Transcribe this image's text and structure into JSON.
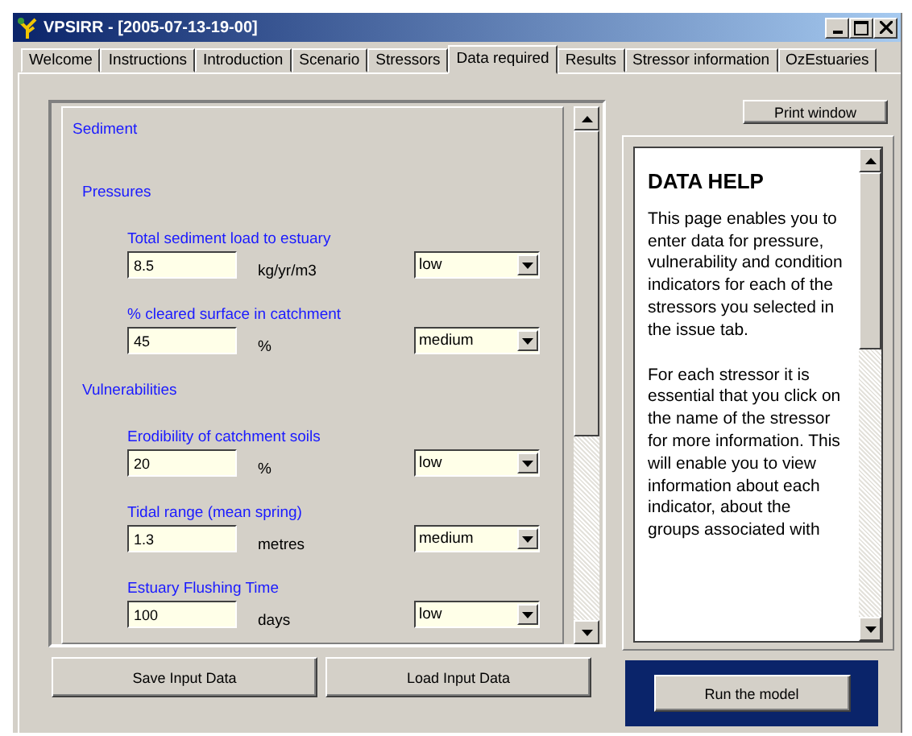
{
  "window": {
    "title": "VPSIRR - [2005-07-13-19-00]"
  },
  "tabs": [
    {
      "label": "Welcome",
      "selected": false
    },
    {
      "label": "Instructions",
      "selected": false
    },
    {
      "label": "Introduction",
      "selected": false
    },
    {
      "label": "Scenario",
      "selected": false
    },
    {
      "label": "Stressors",
      "selected": false
    },
    {
      "label": "Data required",
      "selected": true
    },
    {
      "label": "Results",
      "selected": false
    },
    {
      "label": "Stressor information",
      "selected": false
    },
    {
      "label": "OzEstuaries",
      "selected": false
    }
  ],
  "data_form": {
    "title": "Sediment",
    "groups": [
      {
        "title": "Pressures",
        "fields": [
          {
            "label": "Total sediment load to estuary",
            "value": "8.5",
            "unit": "kg/yr/m3",
            "rating": "low"
          },
          {
            "label": "% cleared surface in catchment",
            "value": "45",
            "unit": "%",
            "rating": "medium"
          }
        ]
      },
      {
        "title": "Vulnerabilities",
        "fields": [
          {
            "label": "Erodibility of catchment soils",
            "value": "20",
            "unit": "%",
            "rating": "low"
          },
          {
            "label": "Tidal range (mean spring)",
            "value": "1.3",
            "unit": "metres",
            "rating": "medium"
          },
          {
            "label": "Estuary Flushing Time",
            "value": "100",
            "unit": "days",
            "rating": "low"
          }
        ]
      }
    ]
  },
  "buttons": [
    "Save Input Data",
    "Load Input Data"
  ],
  "print_button": "Print window",
  "help": {
    "title": "DATA HELP",
    "paragraphs": [
      "This page enables you to enter data for pressure, vulnerability and condition indicators for each of the stressors you selected in the issue tab.",
      "For each stressor it is essential that you click on the name of the stressor for more information.  This will enable you to view information about each indicator, about the groups associated with"
    ]
  },
  "run_button": "Run the model"
}
